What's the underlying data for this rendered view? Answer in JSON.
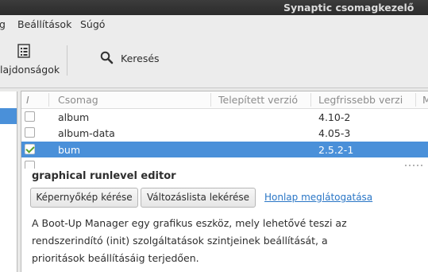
{
  "window": {
    "title": "Synaptic csomagkezelő"
  },
  "menu": {
    "items": [
      "g",
      "Beállítások",
      "Súgó"
    ]
  },
  "toolbar": {
    "properties_label": "lajdonságok",
    "search_label": "Keresés"
  },
  "packages": {
    "columns": [
      "I",
      "Csomag",
      "Telepített verzió",
      "Legfrissebb verzi",
      "M"
    ],
    "rows": [
      {
        "name": "album",
        "installed": "",
        "latest": "4.10-2",
        "checked": false,
        "selected": false
      },
      {
        "name": "album-data",
        "installed": "",
        "latest": "4.05-3",
        "checked": false,
        "selected": false
      },
      {
        "name": "bum",
        "installed": "",
        "latest": "2.5.2-1",
        "checked": true,
        "selected": true
      }
    ]
  },
  "detail": {
    "title": "graphical runlevel editor",
    "screenshot_button": "Képernyőkép kérése",
    "changelog_button": "Változáslista lekérése",
    "homepage_link": "Honlap meglátogatása",
    "description_lines": [
      "A Boot-Up Manager egy grafikus eszköz, mely lehetővé teszi az",
      "rendszerindító (init) szolgáltatások szintjeinek beállítását, a",
      "prioritások beállításáig terjedően."
    ]
  },
  "colors": {
    "selection": "#4a90d9",
    "link": "#2a76c6",
    "check": "#5aa02c"
  },
  "icons": {
    "properties": "properties-icon",
    "search": "search-icon"
  }
}
